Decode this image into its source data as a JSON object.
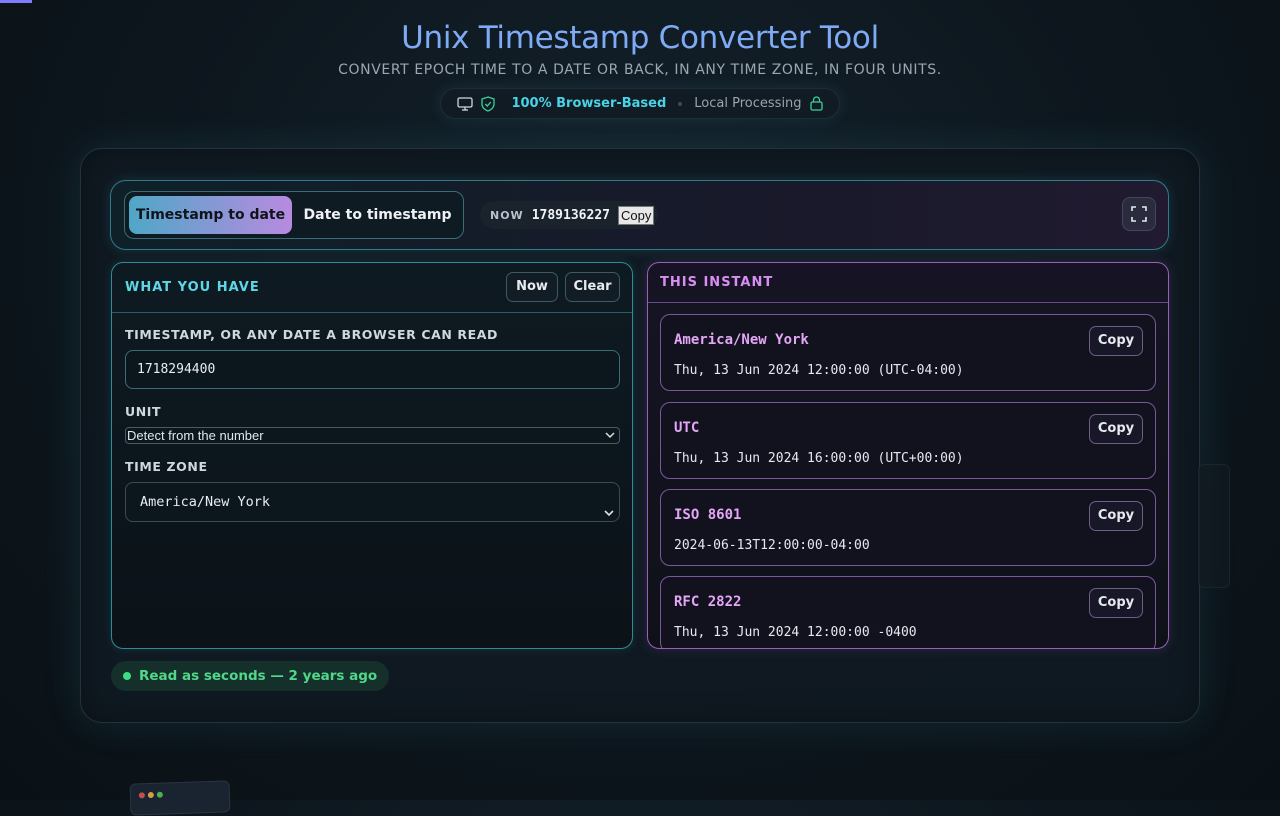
{
  "page": {
    "title": "Unix Timestamp Converter Tool",
    "subtitle": "CONVERT EPOCH TIME TO A DATE OR BACK, IN ANY TIME ZONE, IN FOUR UNITS."
  },
  "badge": {
    "browser_label": "100% Browser-Based",
    "local_label": "Local Processing",
    "icons": [
      "monitor-icon",
      "shield-check-icon",
      "lock-icon"
    ]
  },
  "toolbar": {
    "mode_active": "Timestamp to date",
    "mode_inactive": "Date to timestamp",
    "now_label": "NOW",
    "now_value": "1789136227",
    "copy_label": "Copy",
    "fullscreen_icon": "expand-icon"
  },
  "input_panel": {
    "title": "WHAT YOU HAVE",
    "now_button": "Now",
    "clear_button": "Clear",
    "timestamp_label": "TIMESTAMP, OR ANY DATE A BROWSER CAN READ",
    "timestamp_value": "1718294400",
    "unit_label": "UNIT",
    "unit_value": "Detect from the number",
    "timezone_label": "TIME ZONE",
    "timezone_value": "America/New York"
  },
  "result_panel": {
    "title": "THIS INSTANT",
    "copy_label": "Copy",
    "results": [
      {
        "name": "America/New York",
        "value": "Thu, 13 Jun 2024 12:00:00 (UTC-04:00)"
      },
      {
        "name": "UTC",
        "value": "Thu, 13 Jun 2024 16:00:00 (UTC+00:00)"
      },
      {
        "name": "ISO 8601",
        "value": "2024-06-13T12:00:00-04:00"
      },
      {
        "name": "RFC 2822",
        "value": "Thu, 13 Jun 2024 12:00:00 -0400"
      }
    ]
  },
  "status": {
    "text": "Read as seconds — 2 years ago",
    "color": "#3ddc84"
  },
  "colors": {
    "accent_cyan": "#49d3e6",
    "accent_purple": "#d88ff2",
    "title_blue": "#7faaf6"
  }
}
